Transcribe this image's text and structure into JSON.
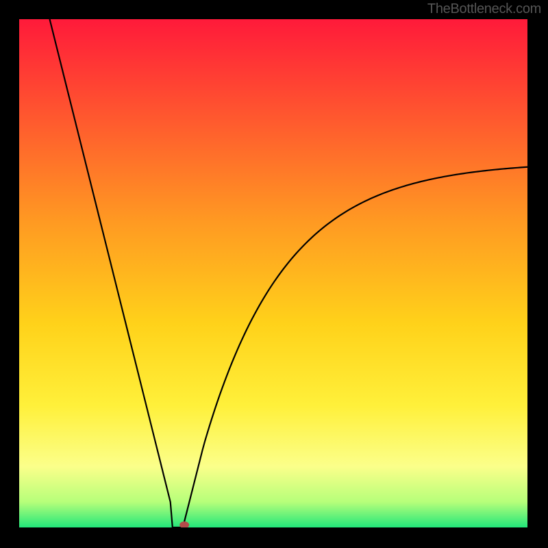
{
  "watermark": "TheBottleneck.com",
  "chart_data": {
    "type": "line",
    "title": "",
    "xlabel": "",
    "ylabel": "",
    "xlim": [
      0,
      1
    ],
    "ylim": [
      0,
      1
    ],
    "curve": {
      "left_branch": {
        "x_start": 0.06,
        "y_start": 1.0,
        "x_end": 0.31,
        "y_end": 0.0
      },
      "right_branch": {
        "x_start": 0.31,
        "y_start": 0.0,
        "x_end": 1.0,
        "y_end": 0.72
      },
      "minimum_x": 0.31,
      "minimum_y": 0.0
    },
    "marker": {
      "x": 0.325,
      "y": 0.005,
      "color": "#b54a4a"
    },
    "gradient_stops": [
      {
        "offset": 0.0,
        "color": "#ff1a3a"
      },
      {
        "offset": 0.2,
        "color": "#ff5a2e"
      },
      {
        "offset": 0.4,
        "color": "#ff9a22"
      },
      {
        "offset": 0.6,
        "color": "#ffd21a"
      },
      {
        "offset": 0.76,
        "color": "#fff03a"
      },
      {
        "offset": 0.88,
        "color": "#fbff8a"
      },
      {
        "offset": 0.95,
        "color": "#b6ff7a"
      },
      {
        "offset": 1.0,
        "color": "#22e67a"
      }
    ]
  }
}
